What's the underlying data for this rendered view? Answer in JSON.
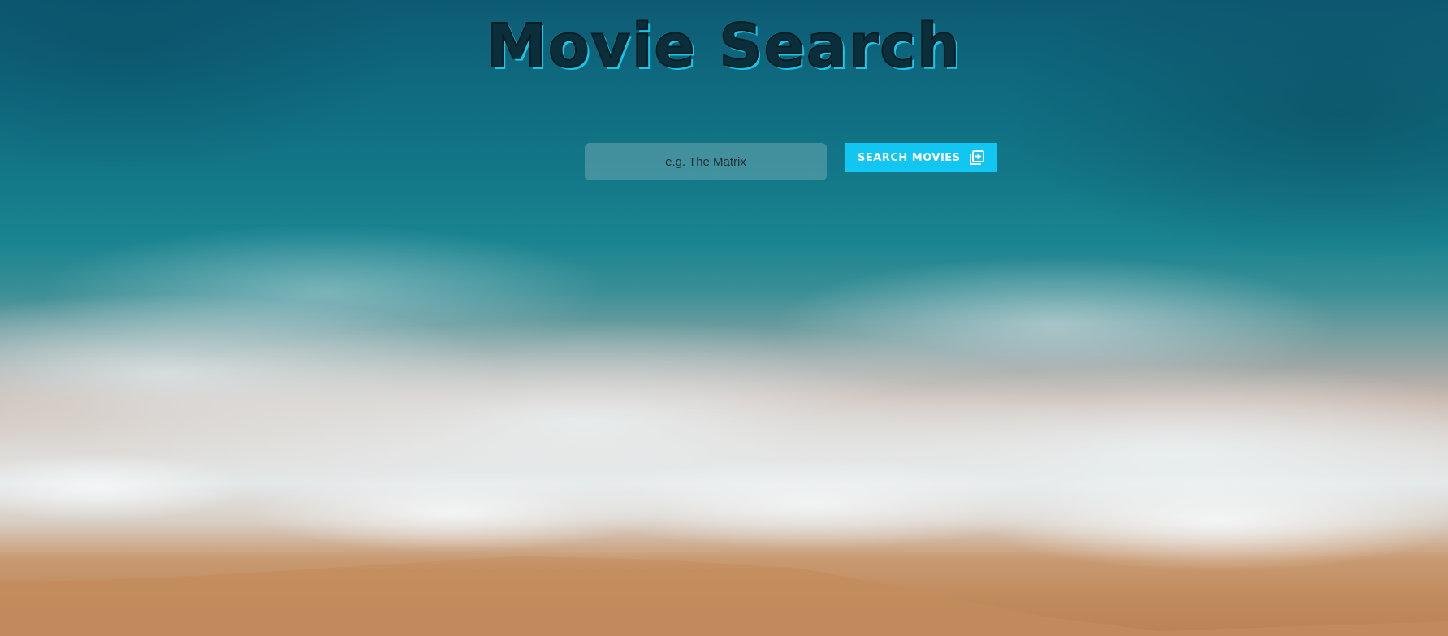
{
  "app": {
    "title": "Movie Search"
  },
  "search": {
    "placeholder": "e.g. The Matrix",
    "value": ""
  },
  "button": {
    "label": "SEARCH MOVIES",
    "icon": "add-to-queue-icon"
  },
  "colors": {
    "accent": "#12c6f2",
    "title_fill": "#0b2f3a",
    "title_shadow": "#16c8e8"
  }
}
